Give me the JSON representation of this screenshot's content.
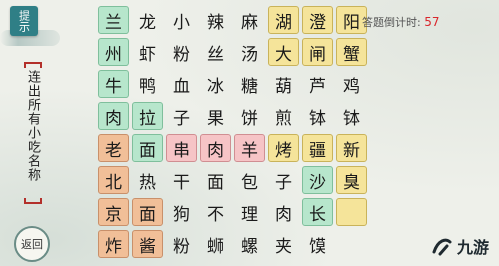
{
  "hint_label": "提示",
  "task_text": "连出所有小吃名称",
  "back_label": "返回",
  "timer": {
    "label": "答题倒计时:",
    "value": "57"
  },
  "watermark": "九游",
  "grid": [
    [
      {
        "t": "兰",
        "c": "green"
      },
      {
        "t": "龙",
        "c": "plain"
      },
      {
        "t": "小",
        "c": "plain"
      },
      {
        "t": "辣",
        "c": "plain"
      },
      {
        "t": "麻",
        "c": "plain"
      },
      {
        "t": "湖",
        "c": "yellow"
      },
      {
        "t": "澄",
        "c": "yellow"
      },
      {
        "t": "阳",
        "c": "yellow"
      }
    ],
    [
      {
        "t": "州",
        "c": "green"
      },
      {
        "t": "虾",
        "c": "plain"
      },
      {
        "t": "粉",
        "c": "plain"
      },
      {
        "t": "丝",
        "c": "plain"
      },
      {
        "t": "汤",
        "c": "plain"
      },
      {
        "t": "大",
        "c": "yellow"
      },
      {
        "t": "闸",
        "c": "yellow"
      },
      {
        "t": "蟹",
        "c": "yellow"
      }
    ],
    [
      {
        "t": "牛",
        "c": "green"
      },
      {
        "t": "鸭",
        "c": "plain"
      },
      {
        "t": "血",
        "c": "plain"
      },
      {
        "t": "冰",
        "c": "plain"
      },
      {
        "t": "糖",
        "c": "plain"
      },
      {
        "t": "葫",
        "c": "plain"
      },
      {
        "t": "芦",
        "c": "plain"
      },
      {
        "t": "鸡",
        "c": "plain"
      }
    ],
    [
      {
        "t": "肉",
        "c": "green"
      },
      {
        "t": "拉",
        "c": "green"
      },
      {
        "t": "子",
        "c": "plain"
      },
      {
        "t": "果",
        "c": "plain"
      },
      {
        "t": "饼",
        "c": "plain"
      },
      {
        "t": "煎",
        "c": "plain"
      },
      {
        "t": "钵",
        "c": "plain"
      },
      {
        "t": "钵",
        "c": "plain"
      }
    ],
    [
      {
        "t": "老",
        "c": "orange"
      },
      {
        "t": "面",
        "c": "green"
      },
      {
        "t": "串",
        "c": "pink"
      },
      {
        "t": "肉",
        "c": "pink"
      },
      {
        "t": "羊",
        "c": "pink"
      },
      {
        "t": "烤",
        "c": "yellow"
      },
      {
        "t": "疆",
        "c": "yellow"
      },
      {
        "t": "新",
        "c": "yellow"
      }
    ],
    [
      {
        "t": "北",
        "c": "orange"
      },
      {
        "t": "热",
        "c": "plain"
      },
      {
        "t": "干",
        "c": "plain"
      },
      {
        "t": "面",
        "c": "plain"
      },
      {
        "t": "包",
        "c": "plain"
      },
      {
        "t": "子",
        "c": "plain"
      },
      {
        "t": "沙",
        "c": "green"
      },
      {
        "t": "臭",
        "c": "yellow"
      }
    ],
    [
      {
        "t": "京",
        "c": "orange"
      },
      {
        "t": "面",
        "c": "orange"
      },
      {
        "t": "狗",
        "c": "plain"
      },
      {
        "t": "不",
        "c": "plain"
      },
      {
        "t": "理",
        "c": "plain"
      },
      {
        "t": "肉",
        "c": "plain"
      },
      {
        "t": "长",
        "c": "green"
      },
      {
        "t": "",
        "c": "yellow"
      }
    ],
    [
      {
        "t": "炸",
        "c": "orange"
      },
      {
        "t": "酱",
        "c": "orange"
      },
      {
        "t": "粉",
        "c": "plain"
      },
      {
        "t": "蛳",
        "c": "plain"
      },
      {
        "t": "螺",
        "c": "plain"
      },
      {
        "t": "夹",
        "c": "plain"
      },
      {
        "t": "馍",
        "c": "plain"
      },
      {
        "t": "",
        "c": "plain"
      }
    ]
  ]
}
